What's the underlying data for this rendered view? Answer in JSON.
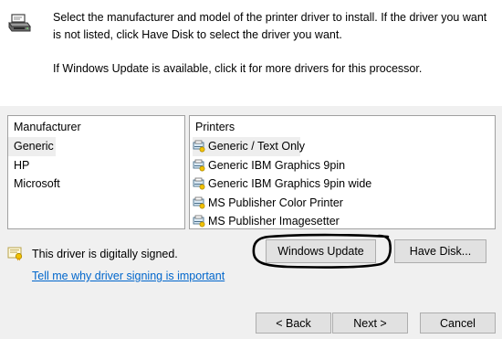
{
  "header": {
    "icon": "printer-driver-icon",
    "line1": "Select the manufacturer and model of the printer driver to install. If the driver you want is not listed, click Have Disk to select the driver you want.",
    "line2": "If Windows Update is available, click it for more drivers for this processor."
  },
  "manufacturer_list": {
    "header": "Manufacturer",
    "items": [
      "Generic",
      "HP",
      "Microsoft"
    ],
    "selected": "Generic"
  },
  "printers_list": {
    "header": "Printers",
    "items": [
      "Generic / Text Only",
      "Generic IBM Graphics 9pin",
      "Generic IBM Graphics 9pin wide",
      "MS Publisher Color Printer",
      "MS Publisher Imagesetter"
    ],
    "selected": "Generic / Text Only"
  },
  "signing": {
    "icon": "signed-driver-icon",
    "status": "This driver is digitally signed.",
    "link": "Tell me why driver signing is important"
  },
  "buttons": {
    "windows_update": "Windows Update",
    "have_disk": "Have Disk...",
    "back": "< Back",
    "next": "Next >",
    "cancel": "Cancel"
  },
  "colors": {
    "link": "#0066cc",
    "button_face": "#e1e1e1",
    "dialog_bg": "#f0f0f0",
    "annotation": "#000000"
  }
}
